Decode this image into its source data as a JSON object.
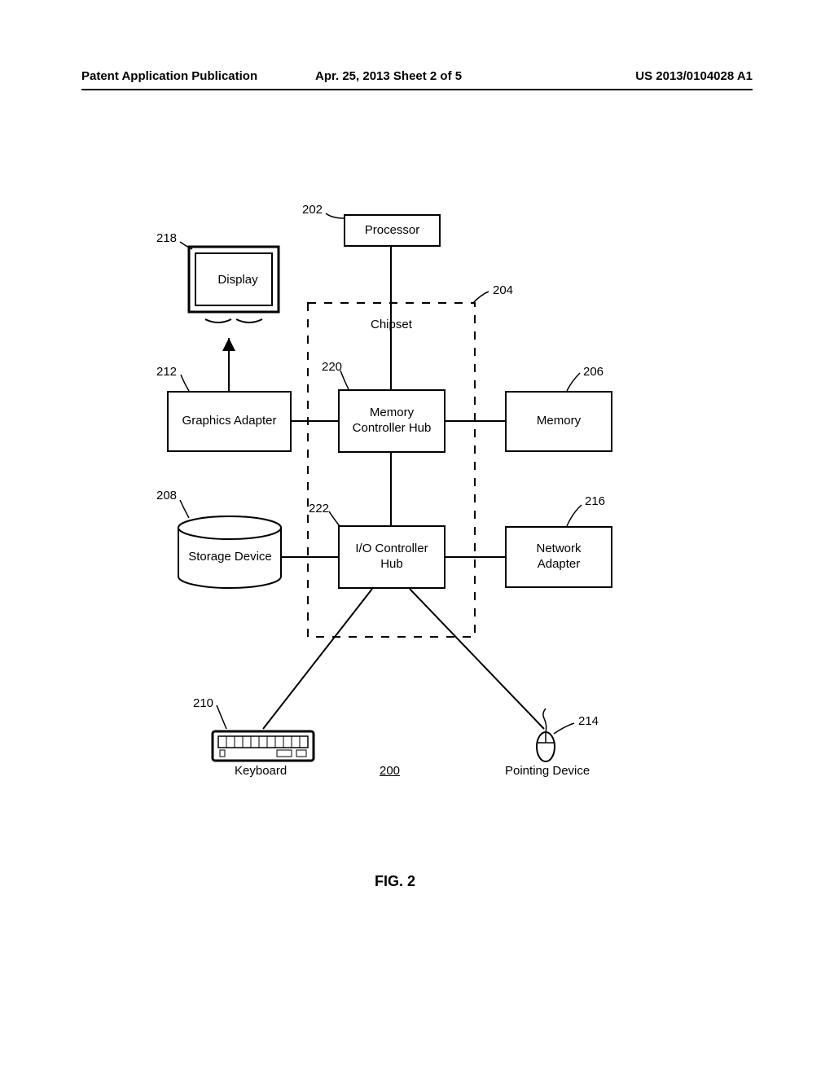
{
  "header": {
    "left": "Patent Application Publication",
    "center": "Apr. 25, 2013  Sheet 2 of 5",
    "right": "US 2013/0104028 A1"
  },
  "nodes": {
    "processor": {
      "label": "Processor",
      "ref": "202"
    },
    "display": {
      "label": "Display",
      "ref": "218"
    },
    "graphics_adapter": {
      "label": "Graphics Adapter",
      "ref": "212"
    },
    "storage_device": {
      "label": "Storage Device",
      "ref": "208"
    },
    "memory": {
      "label": "Memory",
      "ref": "206"
    },
    "network_adapter": {
      "label": "Network\nAdapter",
      "ref": "216"
    },
    "memory_hub": {
      "label": "Memory\nController Hub",
      "ref": "220"
    },
    "io_hub": {
      "label": "I/O Controller\nHub",
      "ref": "222"
    },
    "keyboard": {
      "label": "Keyboard",
      "ref": "210"
    },
    "pointing": {
      "label": "Pointing Device",
      "ref": "214"
    },
    "chipset": {
      "label": "Chipset",
      "ref": "204"
    }
  },
  "figure_number": "200",
  "figure_label": "FIG. 2"
}
